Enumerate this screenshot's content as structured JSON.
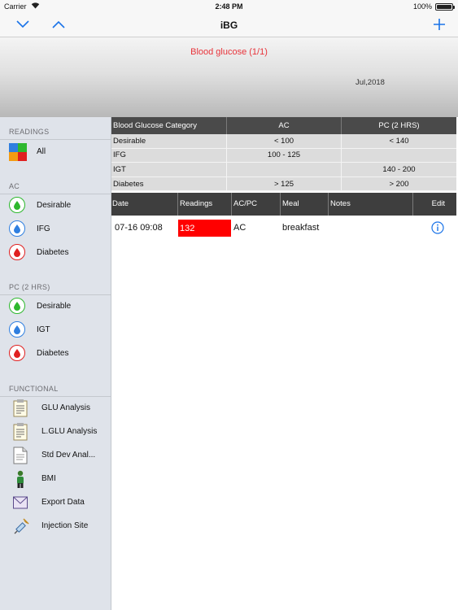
{
  "status": {
    "carrier": "Carrier",
    "time": "2:48 PM",
    "battery": "100%"
  },
  "nav": {
    "title": "iBG",
    "down_icon": "chevron-down-icon",
    "up_icon": "chevron-up-icon",
    "add_icon": "plus-icon"
  },
  "header": {
    "title": "Blood glucose (1/1)",
    "date": "Jul,2018"
  },
  "sidebar": {
    "readings_header": "READINGS",
    "all_label": "All",
    "ac_header": "AC",
    "ac_items": [
      {
        "label": "Desirable",
        "color": "#2eb82e"
      },
      {
        "label": "IFG",
        "color": "#2f7fe0"
      },
      {
        "label": "Diabetes",
        "color": "#e02020"
      }
    ],
    "pc_header": "PC (2 HRS)",
    "pc_items": [
      {
        "label": "Desirable",
        "color": "#2eb82e"
      },
      {
        "label": "IGT",
        "color": "#2f7fe0"
      },
      {
        "label": "Diabetes",
        "color": "#e02020"
      }
    ],
    "functional_header": "FUNCTIONAL",
    "functional_items": [
      {
        "label": "GLU Analysis",
        "icon": "report-icon"
      },
      {
        "label": "L.GLU Analysis",
        "icon": "report-icon"
      },
      {
        "label": "Std Dev Anal...",
        "icon": "document-icon"
      },
      {
        "label": "BMI",
        "icon": "person-icon"
      },
      {
        "label": "Export Data",
        "icon": "mail-icon"
      },
      {
        "label": "Injection Site",
        "icon": "syringe-icon"
      }
    ]
  },
  "category_table": {
    "headers": [
      "Blood Glucose Category",
      "AC",
      "PC (2 HRS)"
    ],
    "rows": [
      [
        "Desirable",
        "< 100",
        "< 140"
      ],
      [
        "IFG",
        "100 - 125",
        ""
      ],
      [
        "IGT",
        "",
        "140 - 200"
      ],
      [
        "Diabetes",
        "> 125",
        "> 200"
      ]
    ]
  },
  "readings_table": {
    "headers": [
      "Date",
      "Readings",
      "AC/PC",
      "Meal",
      "Notes",
      "Edit"
    ],
    "rows": [
      {
        "date": "07-16  09:08",
        "reading": "132",
        "acpc": "AC",
        "meal": "breakfast",
        "notes": ""
      }
    ]
  },
  "colors": {
    "accent": "#1a73e8",
    "danger": "#ff0000",
    "title_red": "#e8333a"
  }
}
